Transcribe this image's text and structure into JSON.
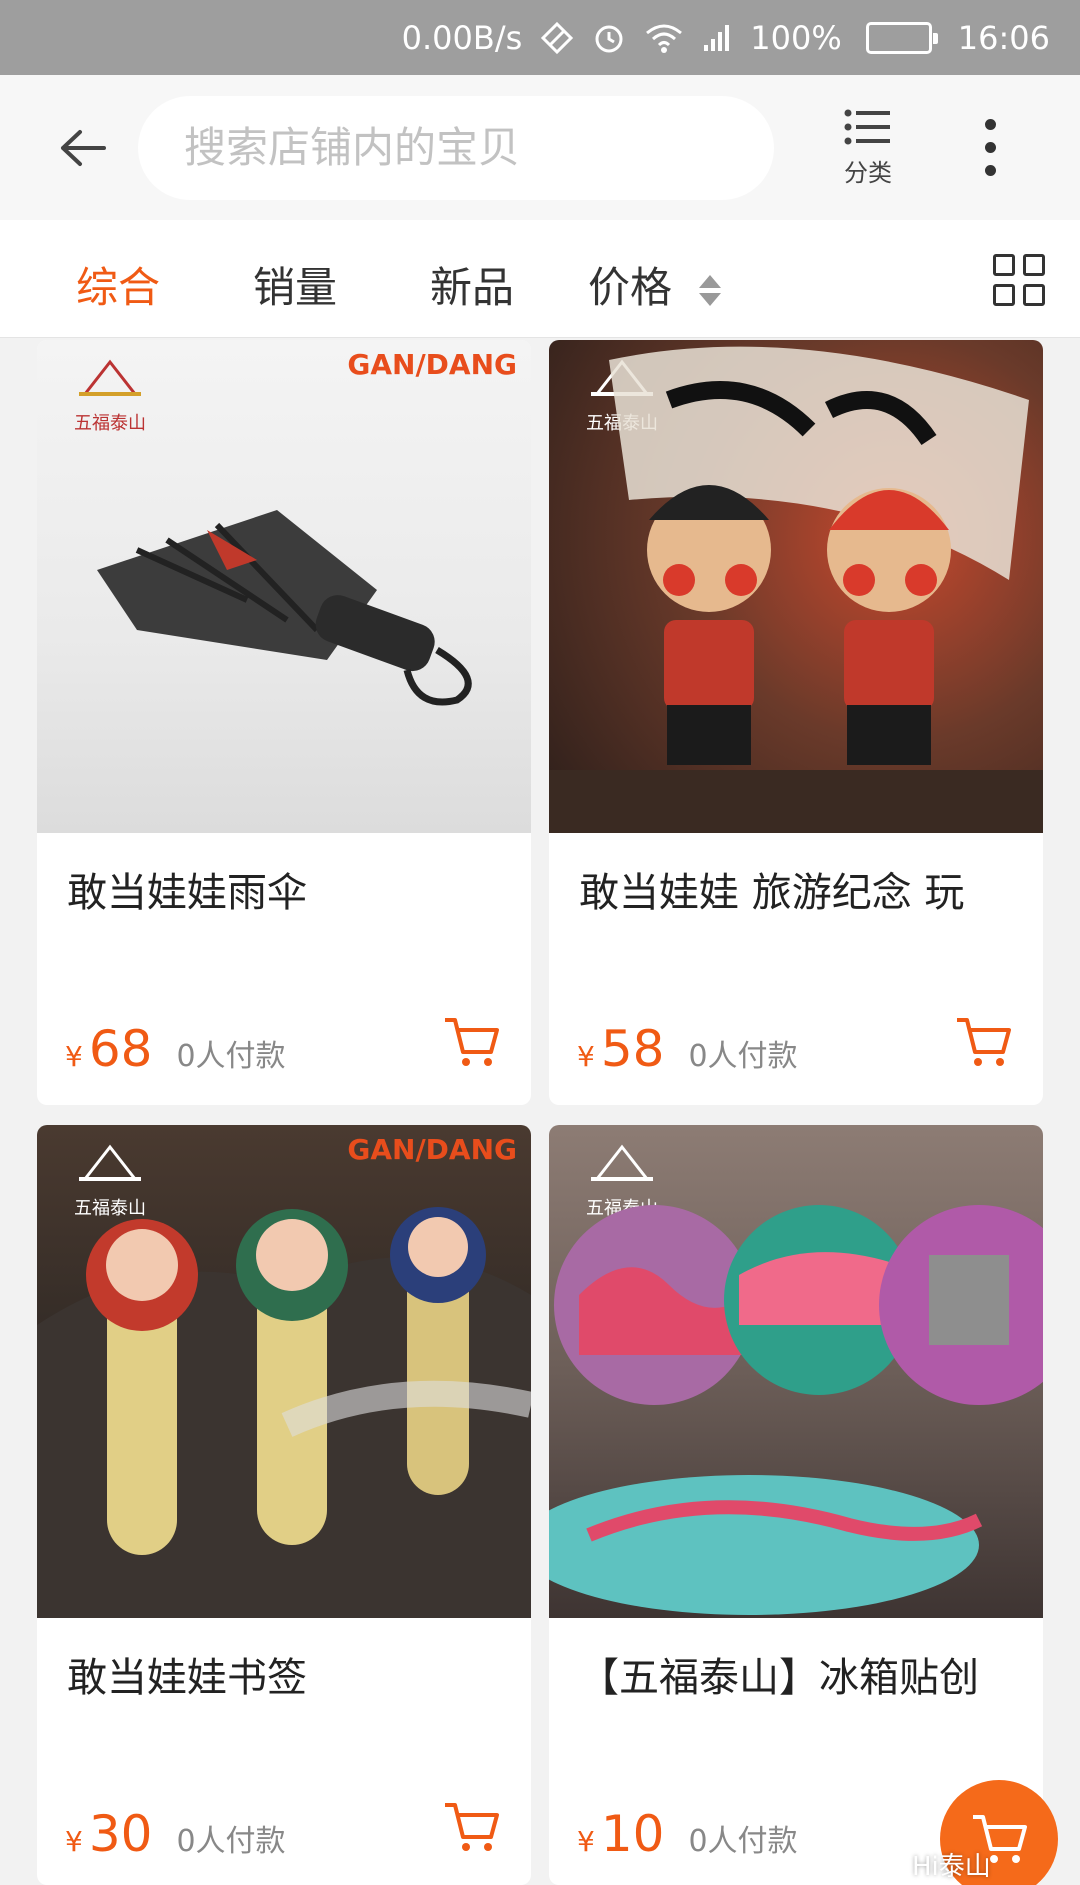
{
  "status_bar": {
    "network_speed": "0.00B/s",
    "battery": "100%",
    "time": "16:06"
  },
  "header": {
    "search_placeholder": "搜索店铺内的宝贝",
    "category_label": "分类"
  },
  "tabs": [
    {
      "label": "综合",
      "active": true
    },
    {
      "label": "销量",
      "active": false
    },
    {
      "label": "新品",
      "active": false
    },
    {
      "label": "价格",
      "active": false
    }
  ],
  "products": [
    {
      "title": "敢当娃娃雨伞",
      "currency": "¥",
      "price": "68",
      "sales": "0人付款"
    },
    {
      "title": "敢当娃娃 旅游纪念 玩",
      "currency": "¥",
      "price": "58",
      "sales": "0人付款"
    },
    {
      "title": "敢当娃娃书签",
      "currency": "¥",
      "price": "30",
      "sales": "0人付款"
    },
    {
      "title": "【五福泰山】冰箱贴创",
      "currency": "¥",
      "price": "10",
      "sales": "0人付款"
    }
  ],
  "image_text": {
    "brand_logo": "五福泰山",
    "gan_dang_logo": "GAN/DANG"
  },
  "watermark": "Hi泰山",
  "colors": {
    "accent": "#f05a14",
    "status_bar": "#9e9e9e",
    "page_background": "#f2f2f2"
  }
}
